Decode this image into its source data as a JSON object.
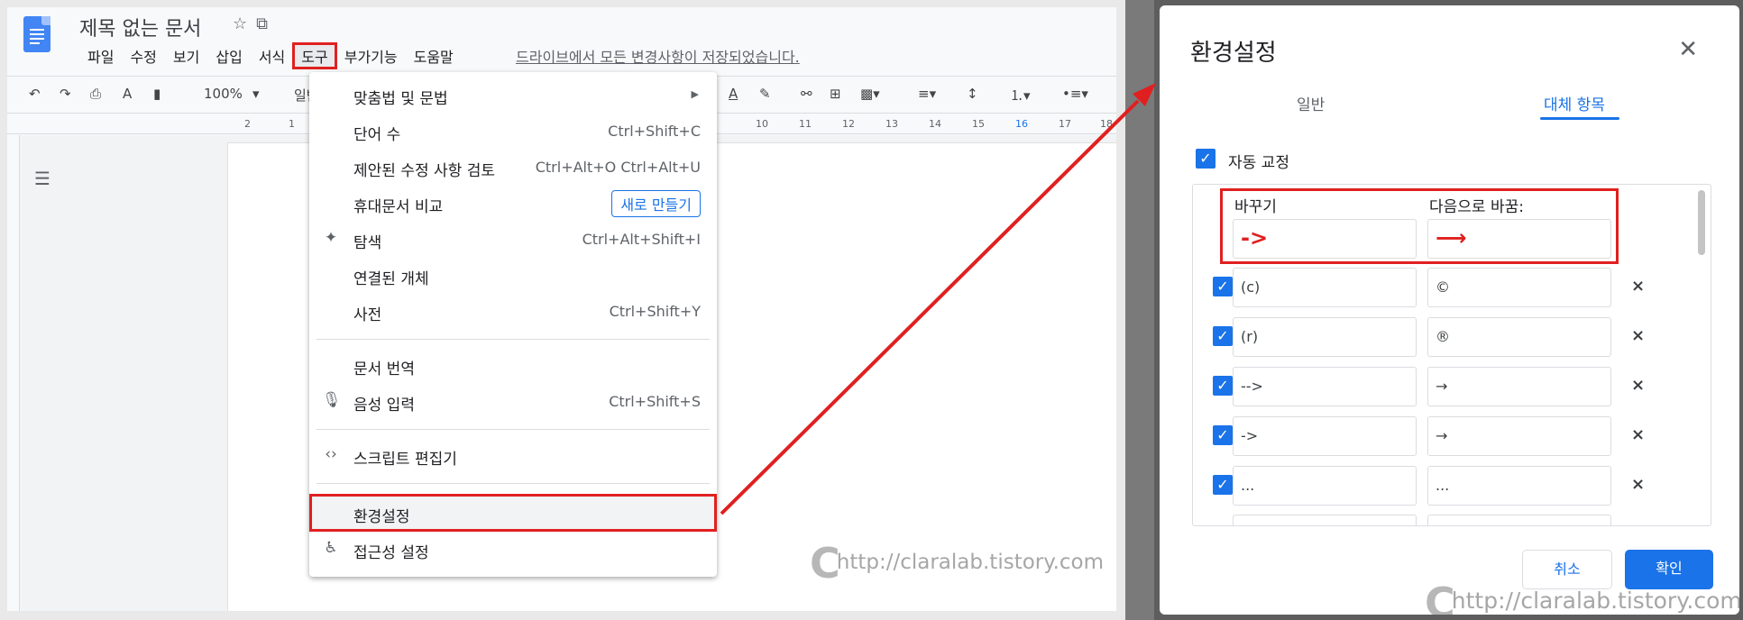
{
  "docs": {
    "title": "제목 없는 문서",
    "menus": [
      "파일",
      "수정",
      "보기",
      "삽입",
      "서식",
      "도구",
      "부가기능",
      "도움말"
    ],
    "active_menu": "도구",
    "save_status": "드라이브에서 모든 변경사항이 저장되었습니다.",
    "toolbar": {
      "zoom": "100%",
      "style": "일반"
    },
    "ruler": [
      "2",
      "1",
      "10",
      "11",
      "12",
      "13",
      "14",
      "15",
      "16",
      "17",
      "18"
    ]
  },
  "tools_menu": {
    "items": [
      {
        "label": "맞춤법 및 문법",
        "shortcut": "",
        "icon": ""
      },
      {
        "label": "단어 수",
        "shortcut": "Ctrl+Shift+C",
        "icon": ""
      },
      {
        "label": "제안된 수정 사항 검토",
        "shortcut": "Ctrl+Alt+O Ctrl+Alt+U",
        "icon": ""
      },
      {
        "label": "휴대문서 비교",
        "badge": "새로 만들기",
        "icon": ""
      },
      {
        "label": "탐색",
        "shortcut": "Ctrl+Alt+Shift+I",
        "icon": "explore-icon"
      },
      {
        "label": "연결된 개체",
        "shortcut": "",
        "icon": ""
      },
      {
        "label": "사전",
        "shortcut": "Ctrl+Shift+Y",
        "icon": ""
      },
      {
        "label": "문서 번역",
        "shortcut": "",
        "icon": ""
      },
      {
        "label": "음성 입력",
        "shortcut": "Ctrl+Shift+S",
        "icon": "mic-icon"
      },
      {
        "label": "스크립트 편집기",
        "shortcut": "",
        "icon": "code-icon"
      },
      {
        "label": "환경설정",
        "shortcut": "",
        "icon": ""
      },
      {
        "label": "접근성 설정",
        "shortcut": "",
        "icon": "accessibility-icon"
      }
    ]
  },
  "watermark": "http://claralab.tistory.com",
  "dialog": {
    "title": "환경설정",
    "tabs": [
      "일반",
      "대체 항목"
    ],
    "active_tab": "대체 항목",
    "autocorrect_label": "자동 교정",
    "col_replace": "바꾸기",
    "col_with": "다음으로 바꿈:",
    "new_replace": "->",
    "new_with": "⟶",
    "rows": [
      {
        "replace": "(c)",
        "with": "©"
      },
      {
        "replace": "(r)",
        "with": "®"
      },
      {
        "replace": "-->",
        "with": "→"
      },
      {
        "replace": "->",
        "with": "→"
      },
      {
        "replace": "...",
        "with": "..."
      }
    ],
    "cancel": "취소",
    "ok": "확인"
  },
  "colors": {
    "accent": "#1a73e8",
    "highlight_red": "#e02020"
  }
}
